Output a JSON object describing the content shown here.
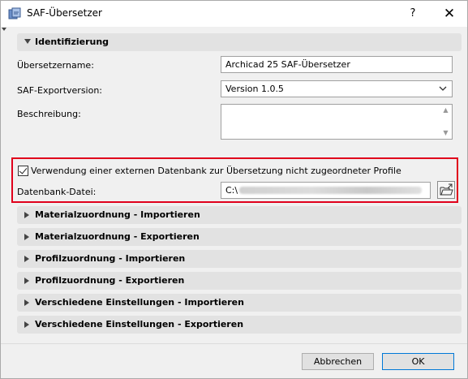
{
  "window": {
    "title": "SAF-Übersetzer",
    "help_label": "?",
    "close_label": "✕"
  },
  "identifizierung": {
    "header": "Identifizierung",
    "translator_name_label": "Übersetzername:",
    "translator_name_value": "Archicad 25 SAF-Übersetzer",
    "export_version_label": "SAF-Exportversion:",
    "export_version_value": "Version 1.0.5",
    "description_label": "Beschreibung:",
    "description_value": ""
  },
  "external_db": {
    "checkbox_label": "Verwendung einer externen Datenbank zur Übersetzung nicht zugeordneter Profile",
    "checked": true,
    "file_label": "Datenbank-Datei:",
    "file_value": "C:\\"
  },
  "sections": [
    {
      "label": "Materialzuordnung - Importieren"
    },
    {
      "label": "Materialzuordnung - Exportieren"
    },
    {
      "label": "Profilzuordnung - Importieren"
    },
    {
      "label": "Profilzuordnung - Exportieren"
    },
    {
      "label": "Verschiedene Einstellungen - Importieren"
    },
    {
      "label": "Verschiedene Einstellungen - Exportieren"
    }
  ],
  "footer": {
    "cancel_label": "Abbrechen",
    "ok_label": "OK"
  },
  "colors": {
    "highlight": "#e0001b",
    "section_bg": "#e2e2e2",
    "ok_border": "#0078d7"
  },
  "icons": {
    "app": "translator-app-icon",
    "browse": "folder-open-icon"
  }
}
